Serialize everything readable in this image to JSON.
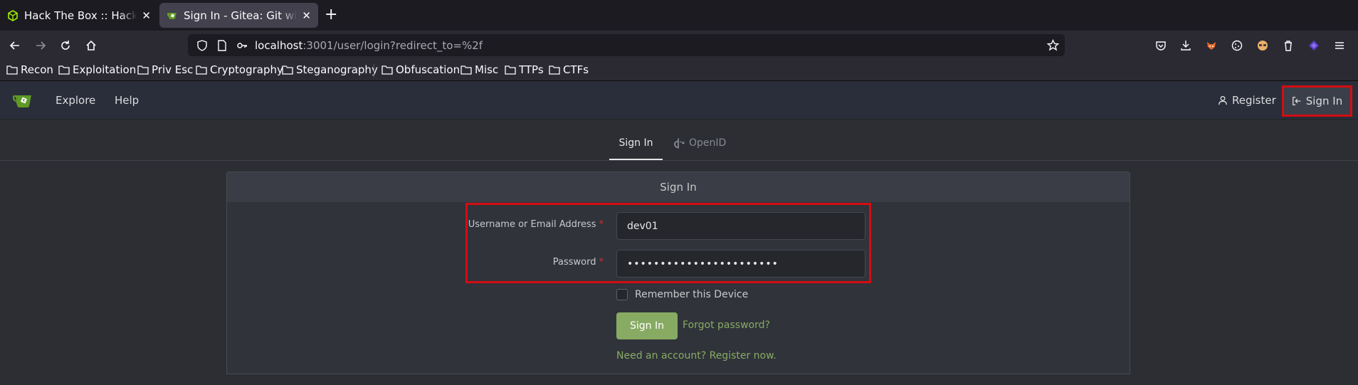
{
  "browser": {
    "tabs": [
      {
        "title": "Hack The Box :: Hack The Box",
        "close": "✕"
      },
      {
        "title": "Sign In - Gitea: Git with a cup of tea",
        "close": "✕"
      }
    ],
    "new_tab": "+",
    "url": {
      "host": "localhost",
      "path": ":3001/user/login?redirect_to=%2f"
    },
    "bookmarks": [
      "Recon",
      "Exploitation",
      "Priv Esc",
      "Cryptography",
      "Steganography",
      "Obfuscation",
      "Misc",
      "TTPs",
      "CTFs"
    ]
  },
  "gitea": {
    "nav": {
      "explore": "Explore",
      "help": "Help",
      "register": "Register",
      "sign_in": "Sign In"
    },
    "tabs": {
      "sign_in": "Sign In",
      "openid": "OpenID"
    },
    "form": {
      "header": "Sign In",
      "username_label": "Username or Email Address",
      "username_value": "dev01",
      "password_label": "Password",
      "password_value": "•••••••••••••••••••••••",
      "required_mark": "*",
      "remember_label": "Remember this Device",
      "remember_checked": false,
      "submit_label": "Sign In",
      "forgot_link": "Forgot password?",
      "register_link": "Need an account? Register now."
    }
  },
  "colors": {
    "accent": "#87ab63",
    "highlight": "#d40d12"
  }
}
